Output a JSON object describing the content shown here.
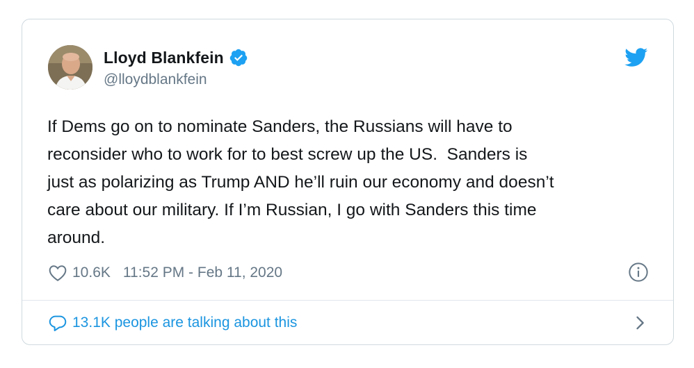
{
  "tweet": {
    "author": {
      "display_name": "Lloyd Blankfein",
      "handle": "@lloydblankfein",
      "verified": true,
      "avatar_icon": "profile-photo"
    },
    "brand_icon": "twitter-bird-icon",
    "text": "If Dems go on to nominate Sanders, the Russians will have to\nreconsider who to work for to best screw up the US.  Sanders is\njust as polarizing as Trump AND he’ll ruin our economy and doesn’t\ncare about our military. If I’m Russian, I go with Sanders this time\naround.",
    "likes": "10.6K",
    "timestamp": "11:52 PM - Feb 11, 2020",
    "talking": "13.1K people are talking about this"
  },
  "colors": {
    "accent": "#1da1f2",
    "link": "#1b95e0",
    "secondary_text": "#657786",
    "border": "#cfd9de"
  }
}
